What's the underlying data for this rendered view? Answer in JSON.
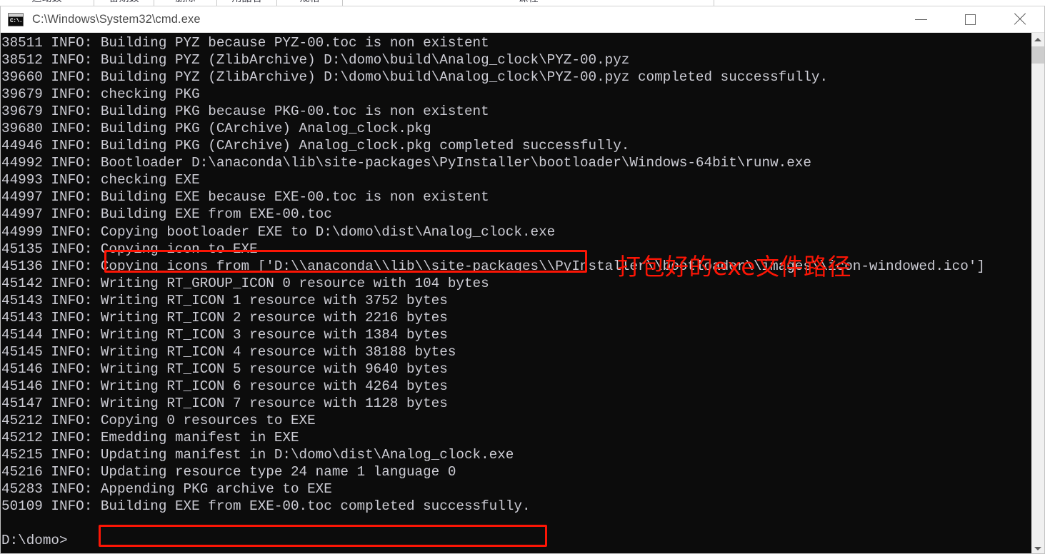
{
  "background_strip": {
    "cells": [
      "运动数",
      "备期数",
      "删除",
      "用品名",
      "规格",
      "课程"
    ]
  },
  "window": {
    "title": "C:\\Windows\\System32\\cmd.exe",
    "icon_name": "cmd-console-icon",
    "icon_text": "C:\\.",
    "controls": {
      "minimize_label": "Minimize",
      "maximize_label": "Maximize",
      "close_label": "Close"
    }
  },
  "console": {
    "background_color": "#0c0c0c",
    "text_color": "#ccccd4",
    "lines": [
      "38511 INFO: Building PYZ because PYZ-00.toc is non existent",
      "38512 INFO: Building PYZ (ZlibArchive) D:\\domo\\build\\Analog_clock\\PYZ-00.pyz",
      "39660 INFO: Building PYZ (ZlibArchive) D:\\domo\\build\\Analog_clock\\PYZ-00.pyz completed successfully.",
      "39679 INFO: checking PKG",
      "39679 INFO: Building PKG because PKG-00.toc is non existent",
      "39680 INFO: Building PKG (CArchive) Analog_clock.pkg",
      "44946 INFO: Building PKG (CArchive) Analog_clock.pkg completed successfully.",
      "44992 INFO: Bootloader D:\\anaconda\\lib\\site-packages\\PyInstaller\\bootloader\\Windows-64bit\\runw.exe",
      "44993 INFO: checking EXE",
      "44997 INFO: Building EXE because EXE-00.toc is non existent",
      "44997 INFO: Building EXE from EXE-00.toc",
      "44999 INFO: Copying bootloader EXE to D:\\domo\\dist\\Analog_clock.exe",
      "45135 INFO: Copying icon to EXE",
      "45136 INFO: Copying icons from ['D:\\\\anaconda\\\\lib\\\\site-packages\\\\PyInstaller\\\\bootloader\\\\images\\\\icon-windowed.ico']",
      "45142 INFO: Writing RT_GROUP_ICON 0 resource with 104 bytes",
      "45143 INFO: Writing RT_ICON 1 resource with 3752 bytes",
      "45143 INFO: Writing RT_ICON 2 resource with 2216 bytes",
      "45144 INFO: Writing RT_ICON 3 resource with 1384 bytes",
      "45145 INFO: Writing RT_ICON 4 resource with 38188 bytes",
      "45146 INFO: Writing RT_ICON 5 resource with 9640 bytes",
      "45146 INFO: Writing RT_ICON 6 resource with 4264 bytes",
      "45147 INFO: Writing RT_ICON 7 resource with 1128 bytes",
      "45212 INFO: Copying 0 resources to EXE",
      "45212 INFO: Emedding manifest in EXE",
      "45215 INFO: Updating manifest in D:\\domo\\dist\\Analog_clock.exe",
      "45216 INFO: Updating resource type 24 name 1 language 0",
      "45283 INFO: Appending PKG archive to EXE",
      "50109 INFO: Building EXE from EXE-00.toc completed successfully.",
      "",
      "D:\\domo>"
    ]
  },
  "annotations": {
    "highlight_color": "#fc1505",
    "boxes": [
      {
        "label": "exe-output-path-highlight"
      },
      {
        "label": "build-success-highlight"
      }
    ],
    "note_text": "打包好的exe文件路径"
  },
  "scrollbar": {
    "up_arrow": "▲",
    "down_arrow": "▼"
  }
}
